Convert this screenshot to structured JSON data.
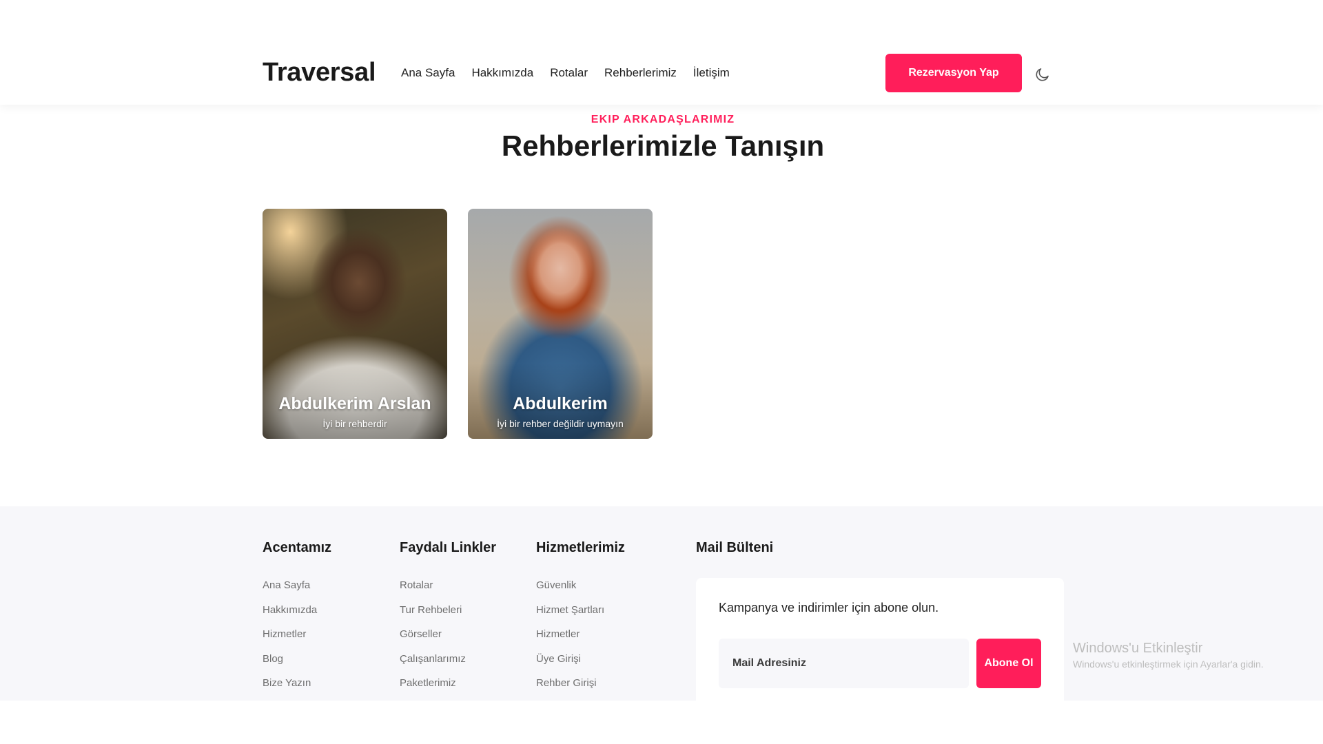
{
  "header": {
    "logo": "Traversal",
    "nav": [
      "Ana Sayfa",
      "Hakkımızda",
      "Rotalar",
      "Rehberlerimiz",
      "İletişim"
    ],
    "cta_label": "Rezervasyon Yap",
    "theme_icon": "moon-icon"
  },
  "section": {
    "eyebrow": "EKIP ARKADAŞLARIMIZ",
    "title": "Rehberlerimizle Tanışın"
  },
  "guides": [
    {
      "name": "Abdulkerim Arslan",
      "description": "İyi bir rehberdir"
    },
    {
      "name": "Abdulkerim",
      "description": "İyi bir rehber değildir uymayın"
    }
  ],
  "footer": {
    "columns": [
      {
        "title": "Acentamız",
        "links": [
          "Ana Sayfa",
          "Hakkımızda",
          "Hizmetler",
          "Blog",
          "Bize Yazın"
        ]
      },
      {
        "title": "Faydalı Linkler",
        "links": [
          "Rotalar",
          "Tur Rehbeleri",
          "Görseller",
          "Çalışanlarımız",
          "Paketlerimiz"
        ]
      },
      {
        "title": "Hizmetlerimiz",
        "links": [
          "Güvenlik",
          "Hizmet Şartları",
          "Hizmetler",
          "Üye Girişi",
          "Rehber Girişi"
        ]
      }
    ],
    "newsletter": {
      "title": "Mail Bülteni",
      "text": "Kampanya ve indirimler için abone olun.",
      "input_placeholder": "Mail Adresiniz",
      "input_value": "",
      "button_label": "Abone Ol"
    }
  },
  "watermark": {
    "title": "Windows'u Etkinleştir",
    "subtitle": "Windows'u etkinleştirmek için Ayarlar'a gidin."
  },
  "colors": {
    "accent": "#ff1e5a",
    "footer_bg": "#f7f7fa"
  }
}
